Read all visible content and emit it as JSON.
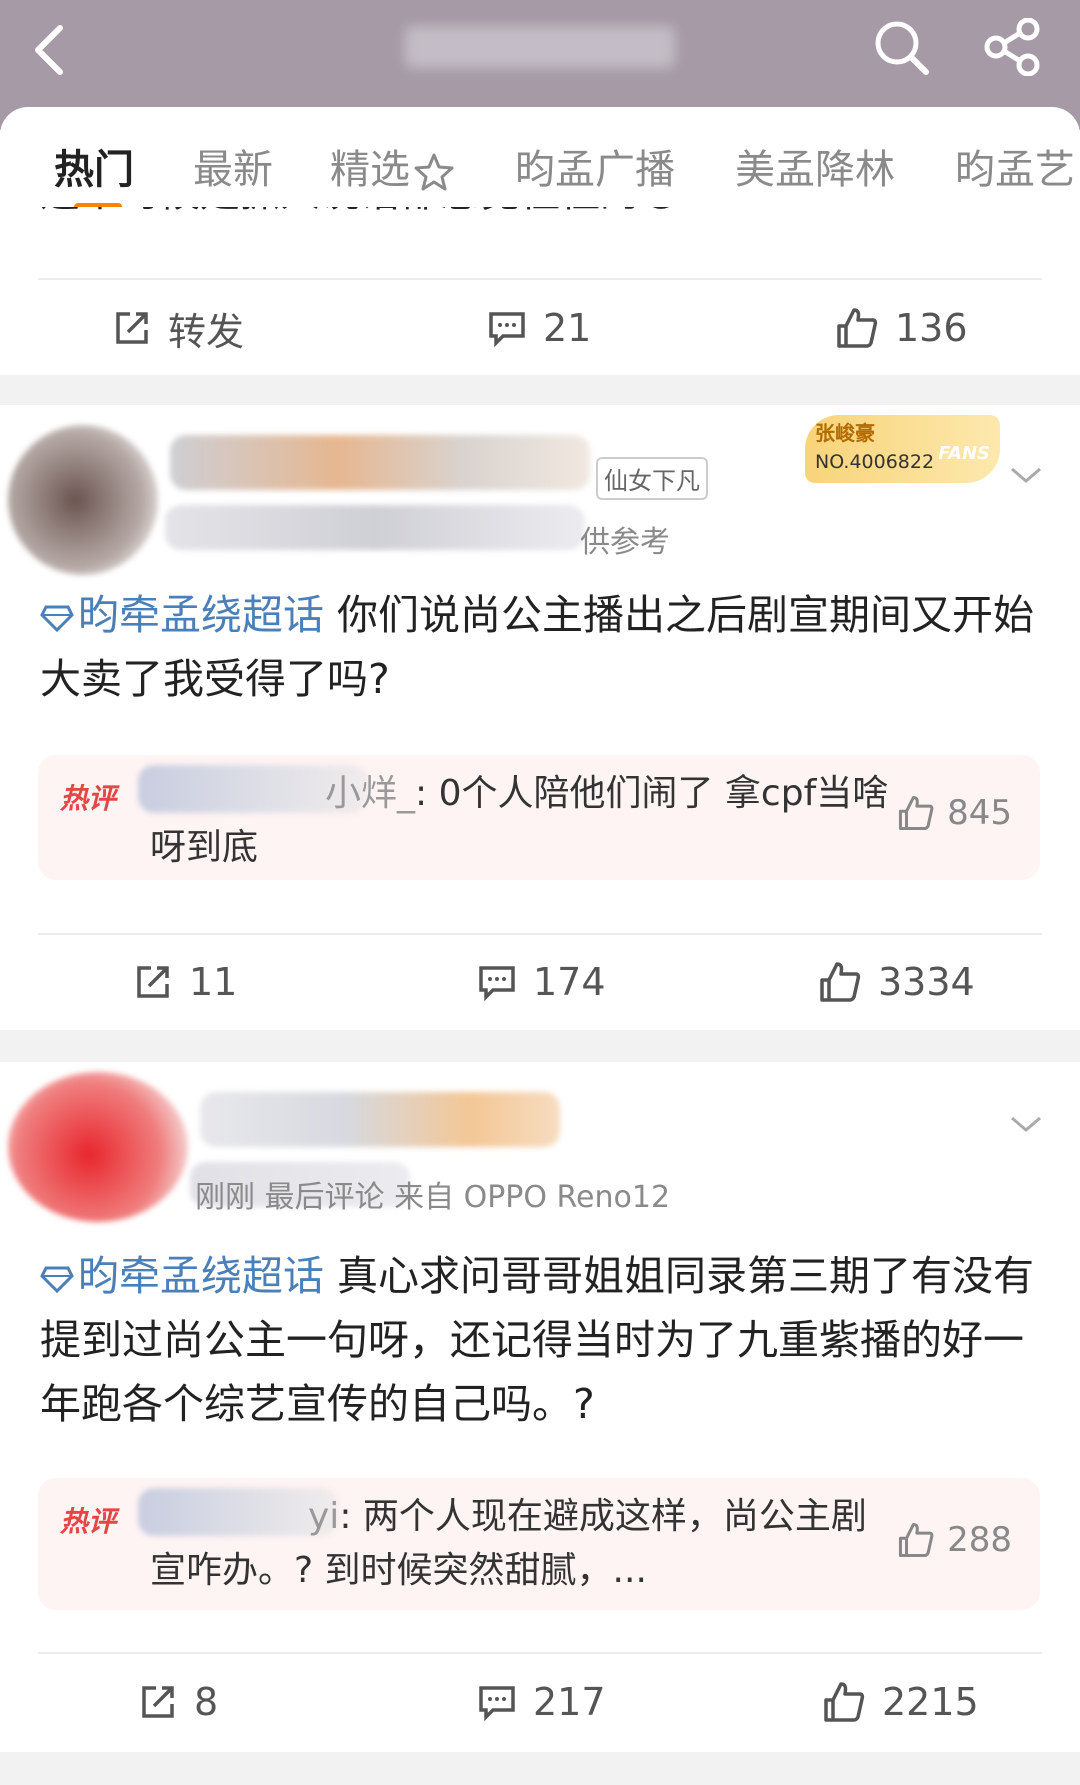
{
  "header": {
    "back_icon": "chevron-left-icon",
    "search_icon": "search-icon",
    "share_icon": "share-icon"
  },
  "tabs": [
    {
      "label": "热门",
      "active": true
    },
    {
      "label": "最新"
    },
    {
      "label": "精选"
    },
    {
      "label": "昀孟广播"
    },
    {
      "label": "美孟降林"
    },
    {
      "label": "昀孟艺"
    }
  ],
  "post1": {
    "cut_text": "这个时候是抓人说话都感觉怪怪的😅",
    "actions": {
      "repost": "转发",
      "comments": "21",
      "likes": "136"
    }
  },
  "post2": {
    "badge_name": "张峻豪",
    "badge_number": "NO.4006822",
    "badge_fans": "FANS",
    "user_tag": "仙女下凡",
    "meta_suffix": "供参考",
    "topic": "昀牵孟绕超话",
    "text": " 你们说尚公主播出之后剧宣期间又开始大卖了我受得了吗?",
    "hot_comment": {
      "tag": "热评",
      "user": "小烊_",
      "text": ": 0个人陪他们闹了 拿cpf当啥呀到底",
      "likes": "845"
    },
    "actions": {
      "repost": "11",
      "comments": "174",
      "likes": "3334"
    }
  },
  "post3": {
    "meta": "刚刚 最后评论  来自 OPPO Reno12",
    "topic": "昀牵孟绕超话",
    "text": " 真心求问哥哥姐姐同录第三期了有没有提到过尚公主一句呀，还记得当时为了九重紫播的好一年跑各个综艺宣传的自己吗。?",
    "hot_comment": {
      "tag": "热评",
      "user": "yi",
      "text": ": 两个人现在避成这样，尚公主剧宣咋办。? 到时候突然甜腻，...",
      "likes": "288"
    },
    "actions": {
      "repost": "8",
      "comments": "217",
      "likes": "2215"
    }
  }
}
